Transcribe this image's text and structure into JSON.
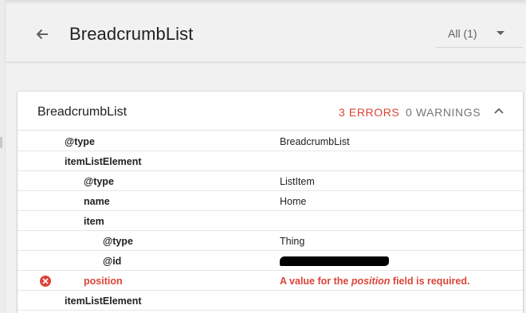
{
  "header": {
    "title": "BreadcrumbList",
    "filter_label": "All (1)"
  },
  "card": {
    "title": "BreadcrumbList",
    "errors": "3 ERRORS",
    "warnings": "0 WARNINGS"
  },
  "rows": [
    {
      "key": "@type",
      "value": "BreadcrumbList"
    },
    {
      "key": "itemListElement",
      "value": ""
    },
    {
      "key": "@type",
      "value": "ListItem"
    },
    {
      "key": "name",
      "value": "Home"
    },
    {
      "key": "item",
      "value": ""
    },
    {
      "key": "@type",
      "value": "Thing"
    },
    {
      "key": "@id",
      "value": ""
    },
    {
      "key": "position",
      "value_pre": "A value for the ",
      "value_em": "position",
      "value_post": " field is required."
    },
    {
      "key": "itemListElement",
      "value": ""
    }
  ],
  "colors": {
    "error": "#db4437",
    "text": "#212121",
    "muted": "#757575"
  },
  "icons": [
    "back-arrow-icon",
    "dropdown-caret-icon",
    "chevron-up-icon",
    "error-icon"
  ]
}
